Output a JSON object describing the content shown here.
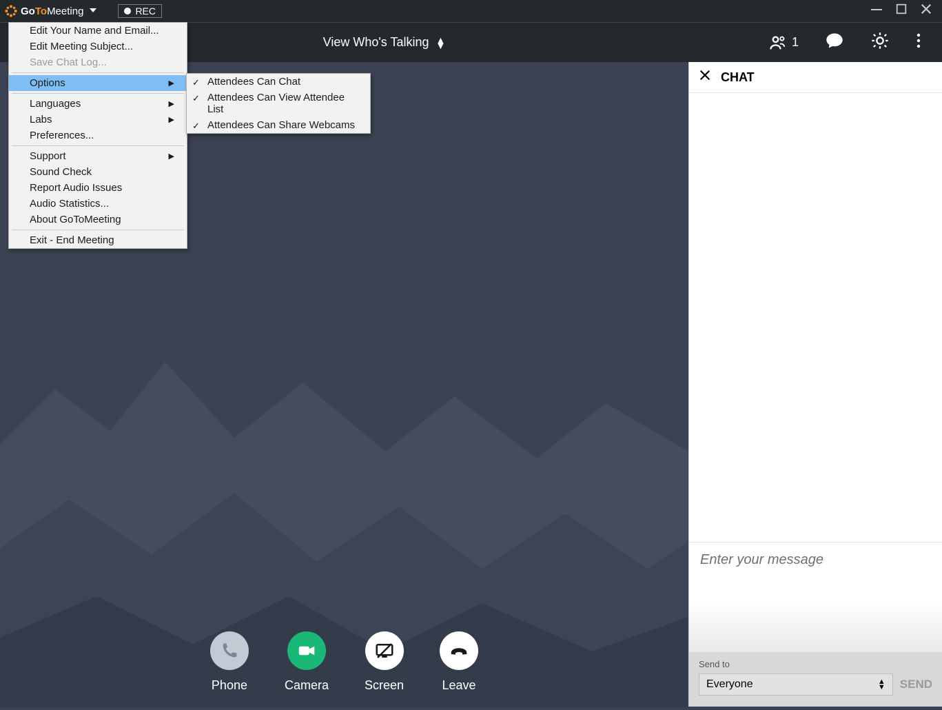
{
  "titlebar": {
    "logo_go": "Go",
    "logo_to": "To",
    "logo_meeting": "Meeting",
    "rec_label": "REC"
  },
  "toolbar": {
    "view_talking": "View Who's Talking",
    "people_count": "1"
  },
  "menu": {
    "edit_name": "Edit Your Name and Email...",
    "edit_subject": "Edit Meeting Subject...",
    "save_chat": "Save Chat Log...",
    "options": "Options",
    "languages": "Languages",
    "labs": "Labs",
    "preferences": "Preferences...",
    "support": "Support",
    "sound_check": "Sound Check",
    "report_audio": "Report Audio Issues",
    "audio_stats": "Audio Statistics...",
    "about": "About GoToMeeting",
    "exit": "Exit - End Meeting"
  },
  "submenu": {
    "attendees_chat": "Attendees Can Chat",
    "attendees_view_list": "Attendees Can View Attendee List",
    "attendees_share_webcams": "Attendees Can Share Webcams"
  },
  "actions": {
    "phone": "Phone",
    "camera": "Camera",
    "screen": "Screen",
    "leave": "Leave"
  },
  "chat": {
    "title": "CHAT",
    "placeholder": "Enter your message",
    "send_to_label": "Send to",
    "send_to_value": "Everyone",
    "send_button": "SEND"
  }
}
